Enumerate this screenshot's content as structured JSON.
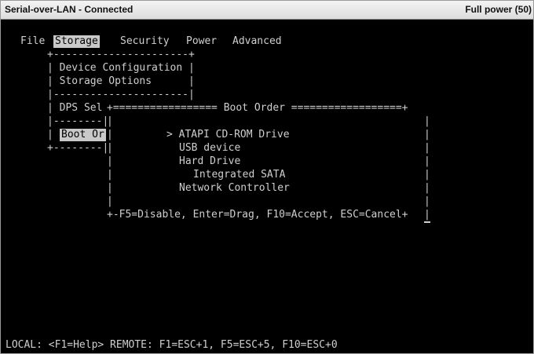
{
  "window": {
    "title": "Serial-over-LAN - Connected",
    "power_status": "Full power (50)"
  },
  "menu_bar": {
    "items": [
      {
        "label": "File",
        "active": false
      },
      {
        "label": "Storage",
        "active": true
      },
      {
        "label": "Security",
        "active": false
      },
      {
        "label": "Power",
        "active": false
      },
      {
        "label": "Advanced",
        "active": false
      }
    ]
  },
  "storage_menu": {
    "border_top": "+----------------------+",
    "line_device_configuration": "| Device Configuration |",
    "line_storage_options": "| Storage Options      |",
    "separator": "|----------------------|",
    "dps_prefix": "| DPS Sel",
    "mini_separator": "|--------|",
    "boot_left": "|",
    "boot_order_truncated": "Boot Or",
    "boot_right": "|",
    "mini_bottom": "+--------|"
  },
  "boot_order_dialog": {
    "top_border": "+================= Boot Order ==================+",
    "left_edges": [
      "|",
      "|",
      "|",
      "|",
      "|",
      "|",
      "|",
      "|"
    ],
    "right_edges": [
      "|",
      "|",
      "|",
      "|",
      "|",
      "|",
      "|",
      "|"
    ],
    "items": [
      {
        "text": "> ATAPI CD-ROM Drive"
      },
      {
        "text": "USB device"
      },
      {
        "text": "Hard Drive"
      },
      {
        "text": "Integrated SATA"
      },
      {
        "text": "Network Controller"
      }
    ],
    "footer": "+-F5=Disable, Enter=Drag, F10=Accept, ESC=Cancel+"
  },
  "status_bar": {
    "text": "LOCAL: <F1=Help> REMOTE: F1=ESC+1, F5=ESC+5, F10=ESC+0"
  },
  "colors": {
    "terminal_bg": "#000000",
    "terminal_fg": "#cfcfcf",
    "highlight_bg": "#c9c9c9",
    "titlebar_bg": "#e8e8e8"
  }
}
